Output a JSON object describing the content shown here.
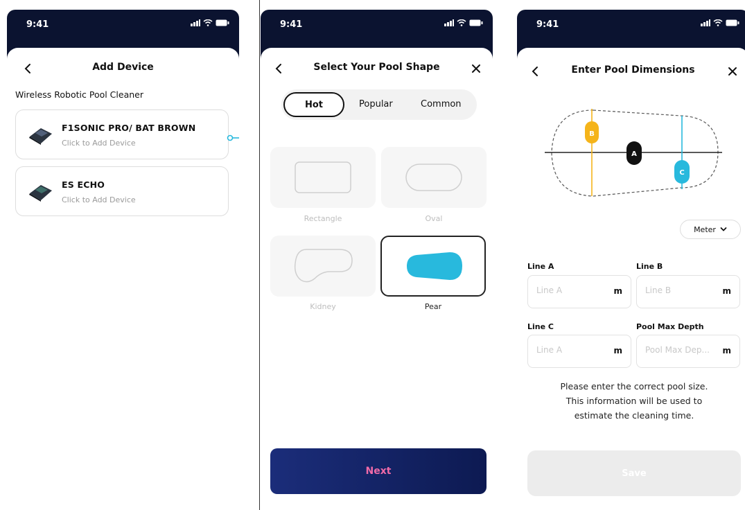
{
  "status": {
    "time": "9:41"
  },
  "screen1": {
    "title": "Add Device",
    "subtitle": "Wireless Robotic Pool Cleaner",
    "devices": [
      {
        "name": "F1SONIC PRO/ BAT BROWN",
        "subtitle": "Click to Add Device"
      },
      {
        "name": "ES ECHO",
        "subtitle": "Click to Add Device"
      }
    ]
  },
  "screen2": {
    "title": "Select Your Pool Shape",
    "tabs": [
      "Hot",
      "Popular",
      "Common"
    ],
    "shapes": [
      {
        "label": "Rectangle",
        "selected": false
      },
      {
        "label": "Oval",
        "selected": false
      },
      {
        "label": "Kidney",
        "selected": false
      },
      {
        "label": "Pear",
        "selected": true
      }
    ],
    "next_label": "Next"
  },
  "screen3": {
    "title": "Enter Pool Dimensions",
    "diagram_labels": {
      "a": "A",
      "b": "B",
      "c": "C"
    },
    "unit_selector": "Meter",
    "fields": [
      {
        "label": "Line A",
        "placeholder": "Line A",
        "unit": "m"
      },
      {
        "label": "Line B",
        "placeholder": "Line B",
        "unit": "m"
      },
      {
        "label": "Line C",
        "placeholder": "Line A",
        "unit": "m"
      },
      {
        "label": "Pool Max Depth",
        "placeholder": "Pool Max Dep...",
        "unit": "m"
      }
    ],
    "note": [
      "Please enter the correct pool size.",
      "This information will be used to",
      "estimate the cleaning time."
    ],
    "save_label": "Save"
  },
  "colors": {
    "accent_blue": "#28b9dd",
    "accent_yellow": "#f5b41a",
    "header_navy": "#0b1330",
    "next_text": "#f06aa8"
  }
}
